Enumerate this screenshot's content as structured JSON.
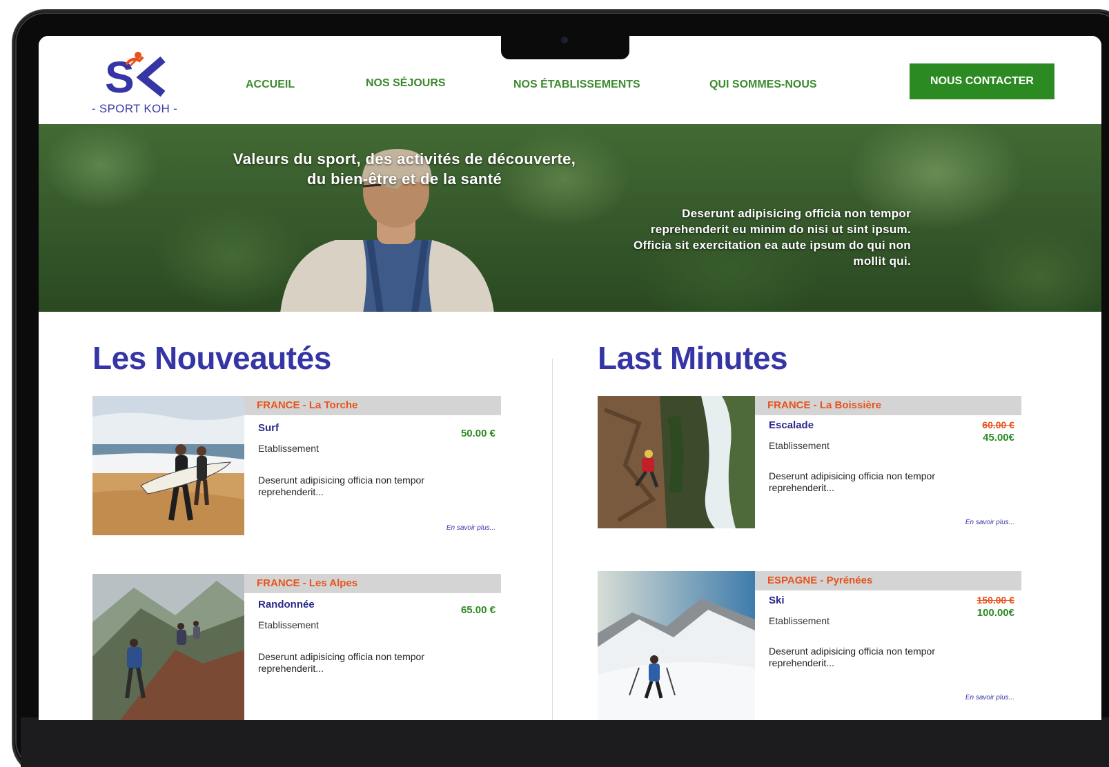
{
  "brand": {
    "logo_text": "- SPORT KOH -",
    "colors": {
      "primary": "#3535a6",
      "accent": "#2b8a22",
      "highlight": "#e8531c"
    }
  },
  "nav": {
    "items": [
      {
        "label": "ACCUEIL"
      },
      {
        "label": "NOS SÉJOURS"
      },
      {
        "label": "NOS ÉTABLISSEMENTS"
      },
      {
        "label": "QUI SOMMES-NOUS"
      }
    ],
    "contact_label": "NOUS CONTACTER"
  },
  "hero": {
    "title_line1": "Valeurs du sport, des activités de découverte,",
    "title_line2": "du bien-être et de la santé",
    "text_line1": "Deserunt adipisicing officia non tempor",
    "text_line2": "reprehenderit eu minim do nisi ut sint ipsum.",
    "text_line3": "Officia sit exercitation ea aute ipsum do qui non",
    "text_line4": "mollit qui."
  },
  "nouveautes": {
    "title": "Les Nouveautés",
    "cards": [
      {
        "location": "FRANCE - La Torche",
        "activity": "Surf",
        "etablissement": "Etablissement",
        "desc_line1": "Deserunt adipisicing officia non tempor",
        "desc_line2": "reprehenderit...",
        "price": "50.00 €",
        "more": "En savoir plus..."
      },
      {
        "location": "FRANCE - Les Alpes",
        "activity": "Randonnée",
        "etablissement": "Etablissement",
        "desc_line1": "Deserunt adipisicing officia non tempor",
        "desc_line2": "reprehenderit...",
        "price": "65.00 €"
      }
    ]
  },
  "last_minutes": {
    "title": "Last Minutes",
    "cards": [
      {
        "location": "FRANCE - La Boissière",
        "activity": "Escalade",
        "etablissement": "Etablissement",
        "desc_line1": "Deserunt adipisicing officia non tempor",
        "desc_line2": "reprehenderit...",
        "old_price": "60.00 €",
        "price": "45.00€",
        "more": "En savoir plus..."
      },
      {
        "location": "ESPAGNE - Pyrénées",
        "activity": "Ski",
        "etablissement": "Etablissement",
        "desc_line1": "Deserunt adipisicing officia non tempor",
        "desc_line2": "reprehenderit...",
        "old_price": "150.00 €",
        "price": "100.00€",
        "more": "En savoir plus..."
      }
    ]
  }
}
